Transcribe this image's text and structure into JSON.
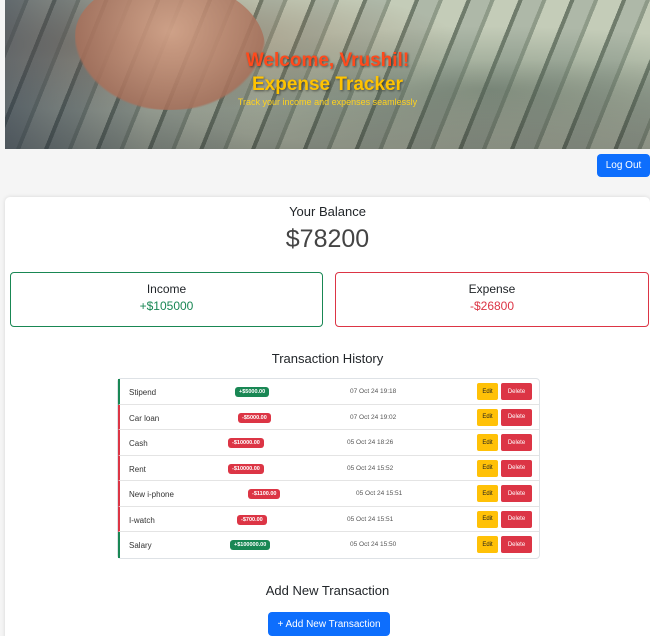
{
  "hero": {
    "welcome": "Welcome, Vrushil!",
    "title": "Expense Tracker",
    "subtitle": "Track your income and expenses seamlessly"
  },
  "header": {
    "logout_label": "Log Out"
  },
  "balance": {
    "label": "Your Balance",
    "value": "$78200"
  },
  "income": {
    "label": "Income",
    "value": "+$105000"
  },
  "expense": {
    "label": "Expense",
    "value": "-$26800"
  },
  "history": {
    "title": "Transaction History",
    "edit_label": "Edit",
    "delete_label": "Delete",
    "transactions": [
      {
        "name": "Stipend",
        "amount": "+$5000.00",
        "type": "pos",
        "date": "07 Oct 24 19:18"
      },
      {
        "name": "Car loan",
        "amount": "-$5000.00",
        "type": "neg",
        "date": "07 Oct 24 19:02"
      },
      {
        "name": "Cash",
        "amount": "-$10000.00",
        "type": "neg",
        "date": "05 Oct 24 18:26"
      },
      {
        "name": "Rent",
        "amount": "-$10000.00",
        "type": "neg",
        "date": "05 Oct 24 15:52"
      },
      {
        "name": "New i-phone",
        "amount": "-$1100.00",
        "type": "neg",
        "date": "05 Oct 24 15:51"
      },
      {
        "name": "I-watch",
        "amount": "-$700.00",
        "type": "neg",
        "date": "05 Oct 24 15:51"
      },
      {
        "name": "Salary",
        "amount": "+$100000.00",
        "type": "pos",
        "date": "05 Oct 24 15:50"
      }
    ]
  },
  "add": {
    "title": "Add New Transaction",
    "button_label": "+ Add New Transaction"
  },
  "colors": {
    "primary": "#0d6efd",
    "success": "#198754",
    "danger": "#dc3545",
    "warning": "#ffc107"
  }
}
